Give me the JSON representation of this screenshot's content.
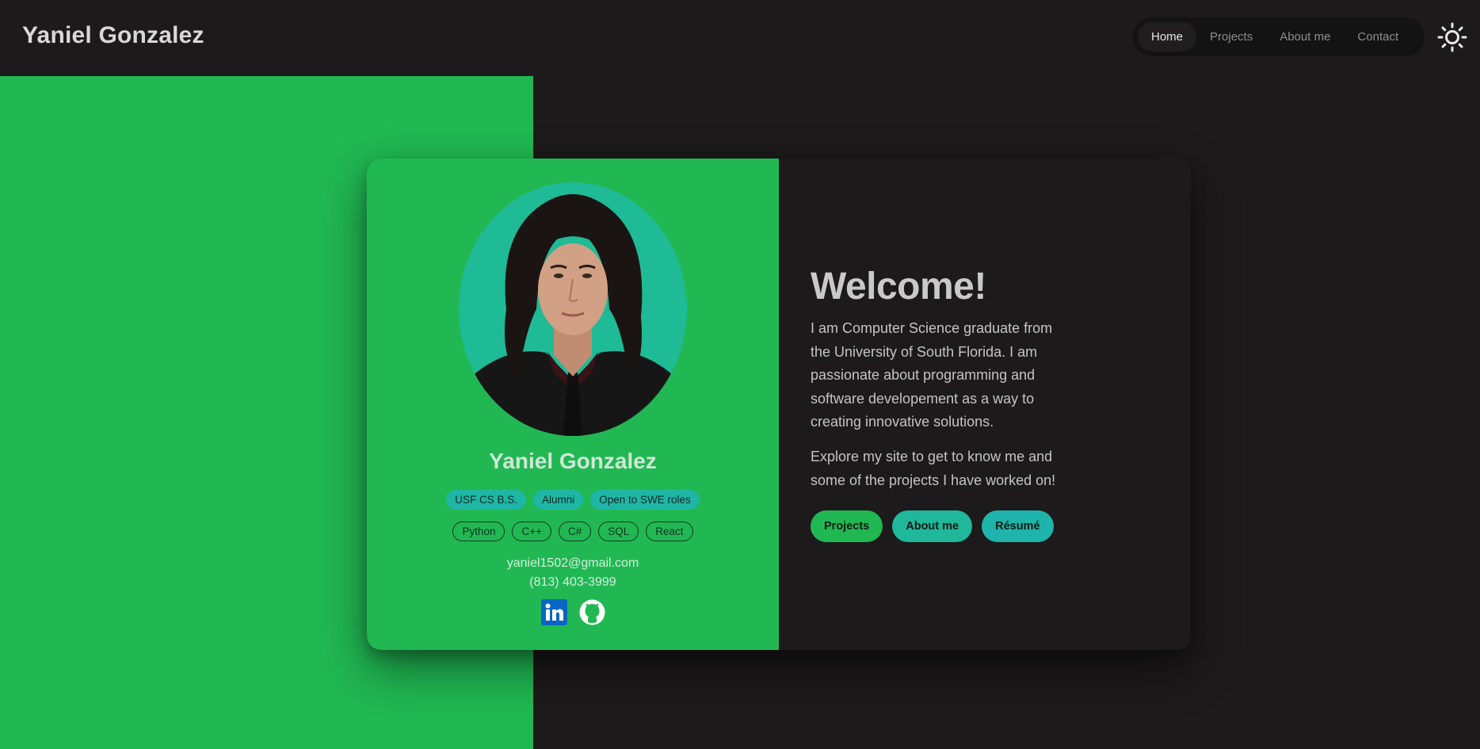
{
  "header": {
    "site_title": "Yaniel Gonzalez",
    "nav": [
      {
        "label": "Home",
        "active": true
      },
      {
        "label": "Projects",
        "active": false
      },
      {
        "label": "About me",
        "active": false
      },
      {
        "label": "Contact",
        "active": false
      }
    ],
    "theme_toggle_icon": "sun-icon"
  },
  "profile": {
    "name": "Yaniel Gonzalez",
    "badges": [
      "USF CS B.S.",
      "Alumni",
      "Open to SWE roles"
    ],
    "skills": [
      "Python",
      "C++",
      "C#",
      "SQL",
      "React"
    ],
    "email": "yaniel1502@gmail.com",
    "phone": "(813) 403-3999",
    "socials": [
      {
        "name": "linkedin-icon",
        "color": "#0a66c2"
      },
      {
        "name": "github-icon",
        "color": "#ffffff"
      }
    ]
  },
  "welcome": {
    "heading": "Welcome!",
    "paragraph1": "I am Computer Science graduate from the University of South Florida. I am passionate about programming and software developement as a way to creating innovative solutions.",
    "paragraph2": "Explore my site to get to know me and some of the projects I have worked on!",
    "buttons": [
      {
        "label": "Projects",
        "color": "#21b853"
      },
      {
        "label": "About me",
        "color": "#1fb89a"
      },
      {
        "label": "Résumé",
        "color": "#1eb4ab"
      }
    ]
  },
  "colors": {
    "background": "#1c1a1a",
    "accent_green": "#21b853",
    "accent_teal": "#1fb6a6"
  }
}
